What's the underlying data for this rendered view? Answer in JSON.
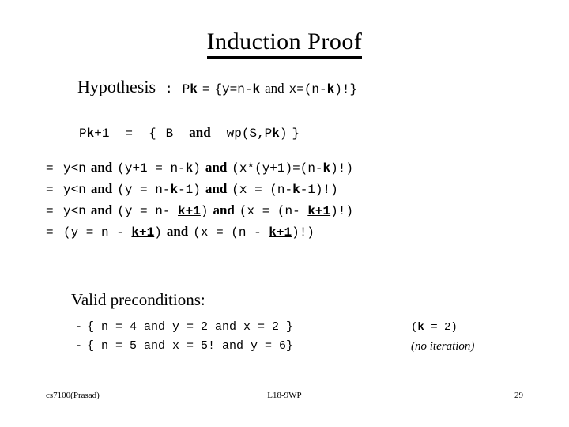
{
  "slide": {
    "title": "Induction Proof"
  },
  "hypothesis": {
    "label": "Hypothesis",
    "colon": ":",
    "lhs": "Pk",
    "lhs_plain": "P",
    "lhs_sub": "k",
    "equals": "=",
    "open_brace": "{",
    "term1": "y=n-",
    "term1_k": "k",
    "and": "and",
    "term2": "x=(n-",
    "term2_k": "k",
    "term2_tail": ")!}"
  },
  "pk_next": {
    "lhs_plain": "P",
    "lhs_sub": "k",
    "lhs_tail": "+1",
    "equals": "=",
    "open_brace": "{",
    "b": "B",
    "and": "and",
    "wp": "wp(S,P",
    "wp_sub": "k",
    "wp_tail": ")",
    "close_brace": "}"
  },
  "derivation": {
    "rows": [
      {
        "eq": "=",
        "part1": "y<n",
        "and1": "and",
        "part2_pre": "(y+1 = n-",
        "part2_k": "k",
        "part2_post": ")",
        "and2": "and",
        "part3_pre": "(x*(y+1)=(n-",
        "part3_k": "k",
        "part3_post": ")!)"
      },
      {
        "eq": "=",
        "part1": "y<n",
        "and1": "and",
        "part2_pre": "(y = n-",
        "part2_k": "k",
        "part2_post": "-1)",
        "and2": "and",
        "part3_pre": "(x  = (n-",
        "part3_k": "k",
        "part3_post": "-1)!)"
      },
      {
        "eq": "=",
        "part1": "y<n",
        "and1": "and",
        "part2_pre": "(y = n- ",
        "part2_k": "k+1",
        "part2_post": ")",
        "and2": "and",
        "part3_pre": "(x = (n- ",
        "part3_k": "k+1",
        "part3_post": ")!)"
      },
      {
        "eq": "=",
        "part1": "",
        "and1": "",
        "part2_pre": "(y = n - ",
        "part2_k": "k+1",
        "part2_post": ")",
        "and2": "and",
        "part3_pre": "(x = (n - ",
        "part3_k": "k+1",
        "part3_post": ")!)"
      }
    ]
  },
  "valid": {
    "heading": "Valid preconditions:",
    "items": [
      {
        "bullet": "-",
        "text_pre": "{ n = 4 and y = 2 and x = 2 }",
        "note_pre": "(",
        "note_k": "k",
        "note_post": " = 2)",
        "note_style": "mono"
      },
      {
        "bullet": "-",
        "text_pre": "{ n = 5 and x = 5! and y = 6}",
        "note_full": "(no iteration)",
        "note_style": "serif"
      }
    ]
  },
  "footer": {
    "left": "cs7100(Prasad)",
    "center": "L18-9WP",
    "right": "29"
  }
}
